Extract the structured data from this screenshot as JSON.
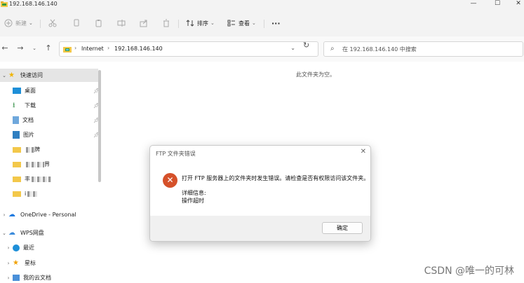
{
  "window": {
    "title": "192.168.146.140",
    "minimize": "—",
    "maximize": "☐",
    "close": "✕"
  },
  "toolbar": {
    "new_label": "新建",
    "sort_label": "排序",
    "view_label": "查看",
    "more": "···"
  },
  "address": {
    "crumb1": "Internet",
    "crumb2": "192.168.146.140",
    "separator": "›"
  },
  "search": {
    "placeholder": "在 192.168.146.140 中搜索"
  },
  "sidebar": {
    "quick_access": "快速访问",
    "items": [
      {
        "label": "桌面",
        "pinned": true
      },
      {
        "label": "下载",
        "pinned": true
      },
      {
        "label": "文档",
        "pinned": true
      },
      {
        "label": "图片",
        "pinned": true
      },
      {
        "label": "牌"
      },
      {
        "label": "界"
      },
      {
        "label": "丰"
      },
      {
        "label": "i"
      }
    ],
    "onedrive": "OneDrive - Personal",
    "wps": "WPS网盘",
    "recent": "最近",
    "starred": "星标",
    "cloud_docs": "我的云文档"
  },
  "content": {
    "empty_message": "此文件夹为空。"
  },
  "dialog": {
    "title": "FTP 文件夹错误",
    "message": "打开 FTP 服务器上的文件夹时发生错误。请检查是否有权限访问该文件夹。",
    "detail_label": "详细信息:",
    "detail_value": "操作超时",
    "ok_label": "确定",
    "close_icon": "✕"
  },
  "watermark": "CSDN @唯一的可林",
  "colors": {
    "error": "#d5512a",
    "folder": "#f3c84a",
    "onedrive": "#1f7ae0",
    "accent": "#0067c0"
  }
}
